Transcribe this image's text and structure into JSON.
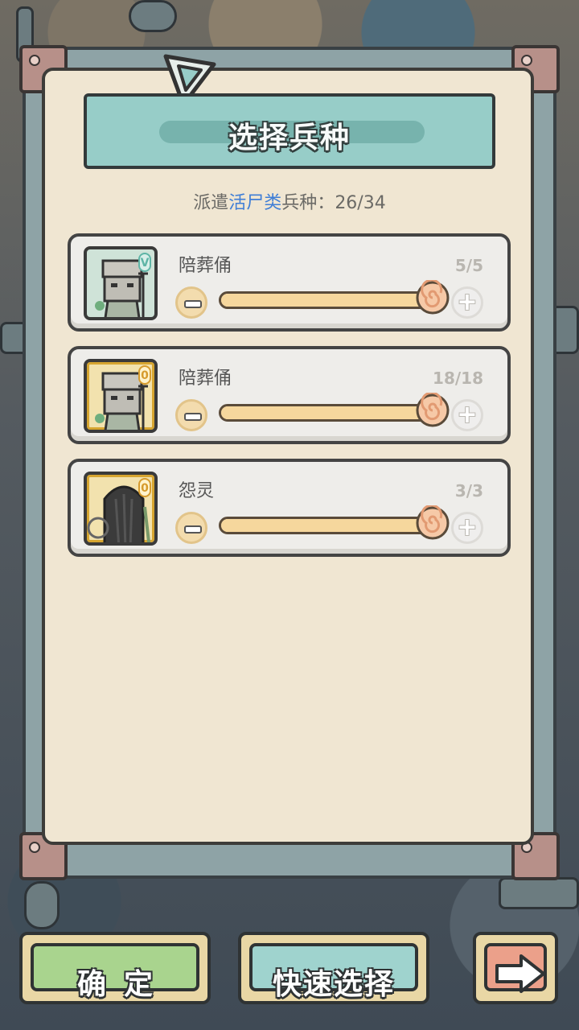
{
  "panel": {
    "title": "选择兵种",
    "dispatch_prefix": "派遣",
    "dispatch_category": "活尸类",
    "dispatch_suffix": "兵种：",
    "dispatch_count": "26/34"
  },
  "units": [
    {
      "name": "陪葬俑",
      "count_text": "5/5",
      "selected": 5,
      "max": 5,
      "fill_fraction": 1.0,
      "rank": "V",
      "portrait": "terracotta-warrior-icon",
      "frame": "green"
    },
    {
      "name": "陪葬俑",
      "count_text": "18/18",
      "selected": 18,
      "max": 18,
      "fill_fraction": 1.0,
      "rank": "0",
      "portrait": "terracotta-warrior-icon",
      "frame": "gold"
    },
    {
      "name": "怨灵",
      "count_text": "3/3",
      "selected": 3,
      "max": 3,
      "fill_fraction": 1.0,
      "rank": "0",
      "portrait": "long-hair-ghost-icon",
      "frame": "gold"
    }
  ],
  "buttons": {
    "confirm": "确定",
    "quick_select": "快速选择",
    "next_icon": "arrow-right-icon"
  },
  "colors": {
    "highlight_blue": "#3f7ed6",
    "title_banner": "#97cdc8",
    "confirm_green": "#a9d48e",
    "quick_teal": "#9fd3ce",
    "next_salmon": "#eba08a"
  }
}
